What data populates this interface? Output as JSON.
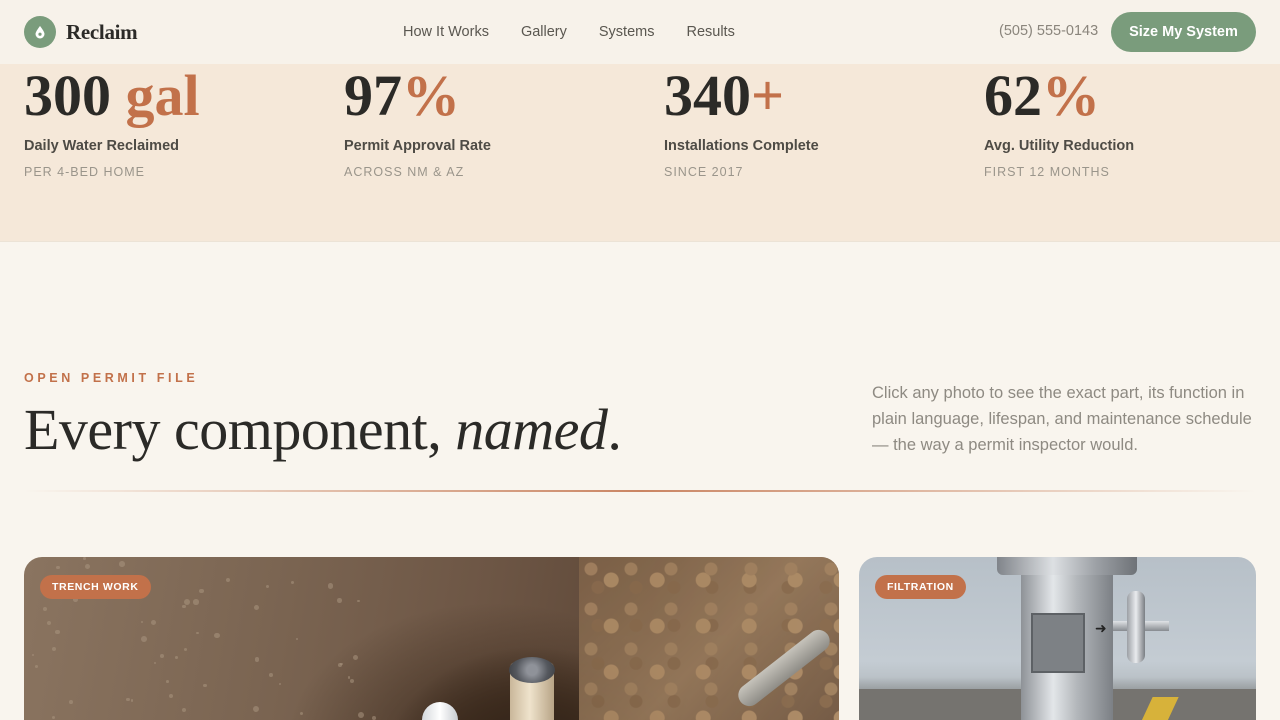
{
  "brand": {
    "name": "Reclaim",
    "logo_icon": "water-drop-icon"
  },
  "nav": {
    "links": [
      "How It Works",
      "Gallery",
      "Systems",
      "Results"
    ],
    "phone": "(505) 555-0143",
    "cta": "Size My System"
  },
  "stats": [
    {
      "number": "300",
      "accent": "gal",
      "label": "Daily Water Reclaimed",
      "sub": "PER 4-BED HOME"
    },
    {
      "number": "97",
      "accent": "%",
      "label": "Permit Approval Rate",
      "sub": "ACROSS NM & AZ"
    },
    {
      "number": "340",
      "accent": "+",
      "label": "Installations Complete",
      "sub": "SINCE 2017"
    },
    {
      "number": "62",
      "accent": "%",
      "label": "Avg. Utility Reduction",
      "sub": "FIRST 12 MONTHS"
    }
  ],
  "section": {
    "eyebrow": "OPEN PERMIT FILE",
    "heading_plain": "Every component, ",
    "heading_italic": "named",
    "heading_end": ".",
    "intro": "Click any photo to see the exact part, its function in plain language, lifespan, and maintenance schedule — the way a permit inspector would."
  },
  "gallery": [
    {
      "tag": "TRENCH WORK"
    },
    {
      "tag": "FILTRATION"
    }
  ],
  "colors": {
    "accent": "#c2714a",
    "brand_green": "#7a9c7c",
    "background": "#f9f5ee",
    "stats_band": "#f5e8d9"
  }
}
